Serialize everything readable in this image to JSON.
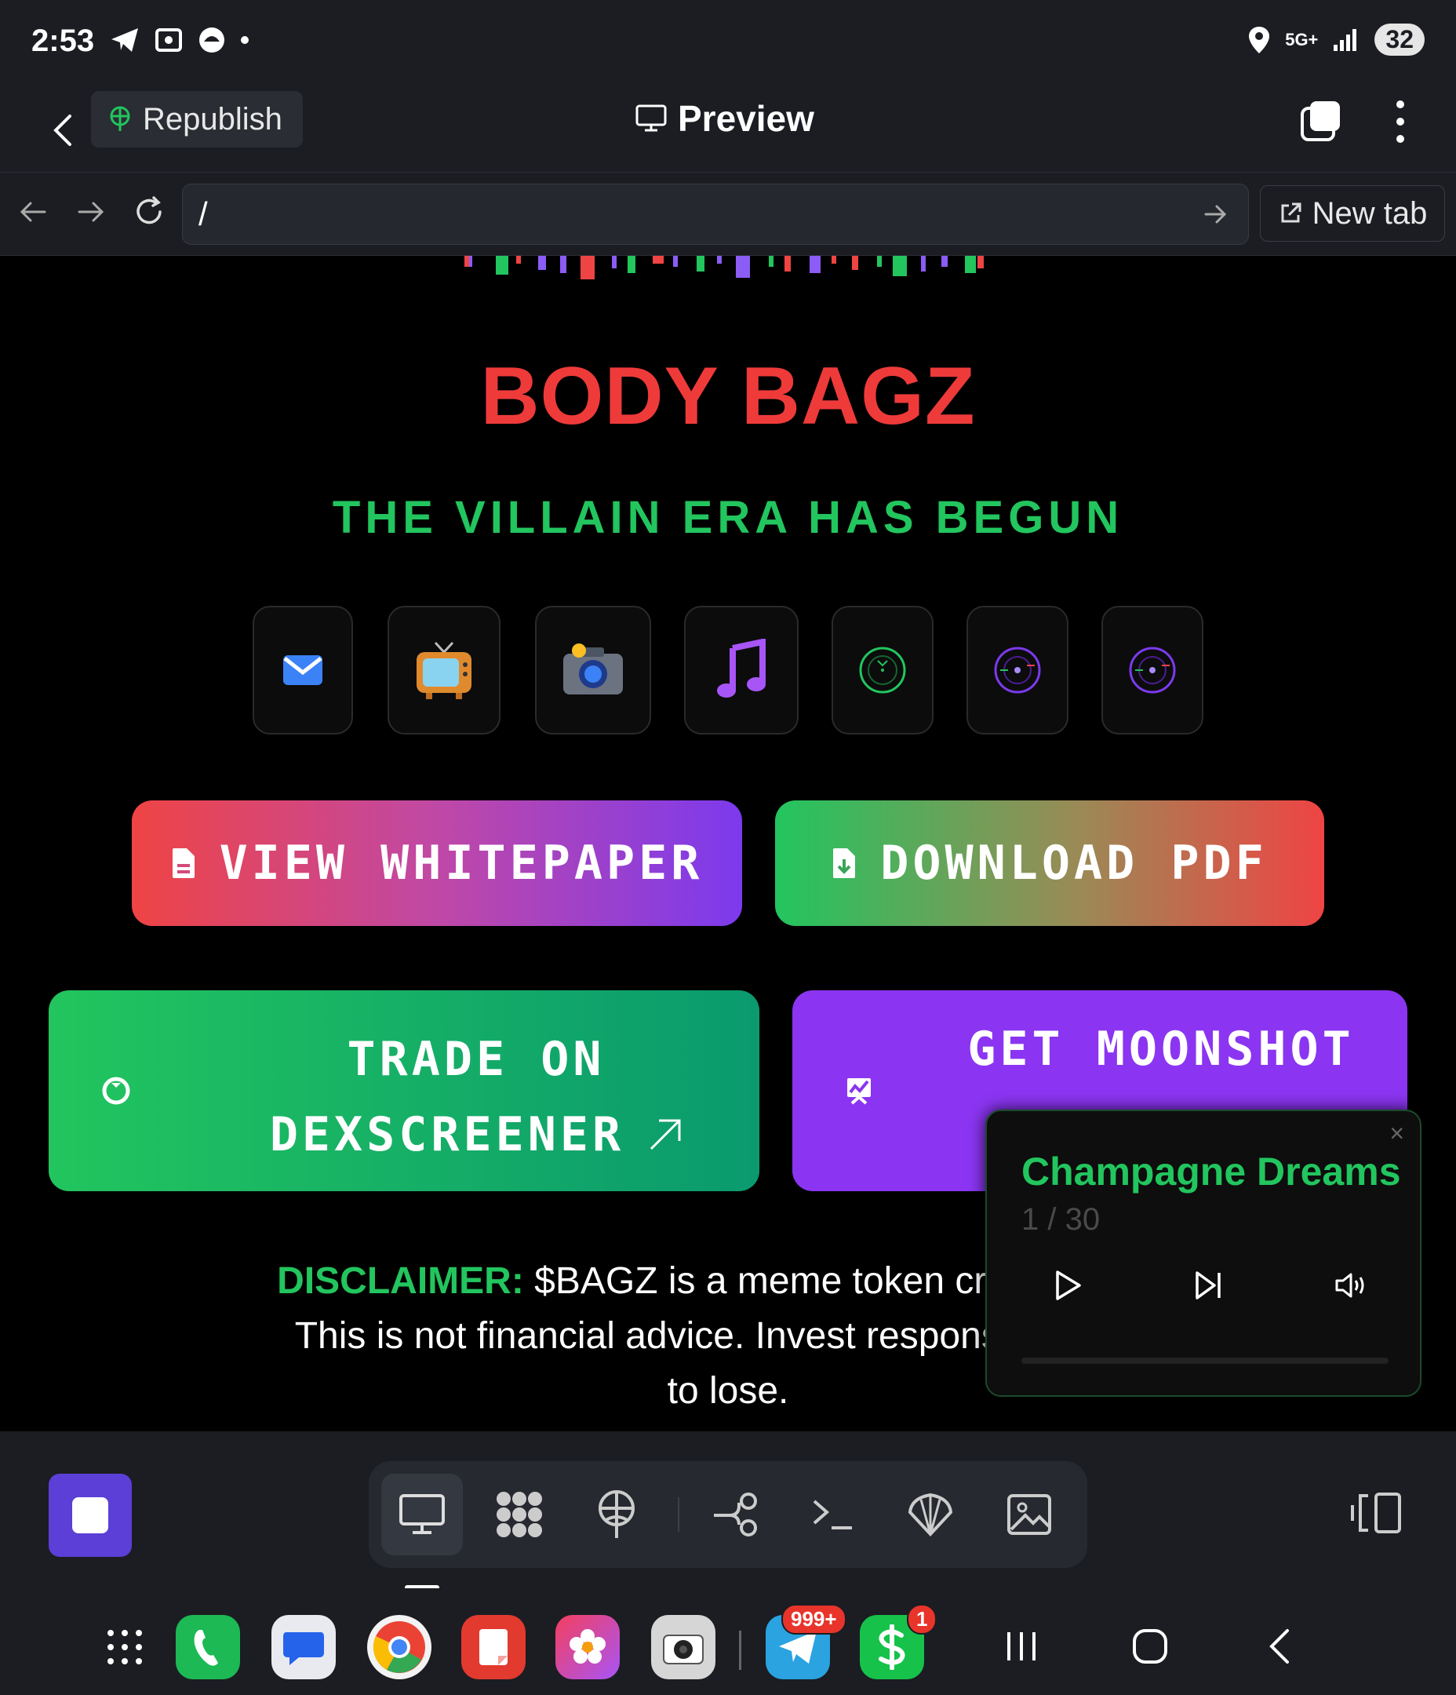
{
  "status_bar": {
    "time": "2:53",
    "network": "5G+",
    "battery": "32"
  },
  "app_bar": {
    "republish_label": "Republish",
    "preview_label": "Preview"
  },
  "url_bar": {
    "url": "/",
    "new_tab_label": "New tab"
  },
  "page": {
    "title": "BODY BAGZ",
    "subtitle": "THE VILLAIN ERA HAS BEGUN",
    "socials": [
      "mail-icon",
      "tv-icon",
      "camera-icon",
      "music-note-icon",
      "radar-icon",
      "orbit-icon",
      "orbit-icon"
    ],
    "buttons": {
      "whitepaper": "VIEW WHITEPAPER",
      "download": "DOWNLOAD PDF",
      "dex_line1": "TRADE ON",
      "dex_line2": "DEXSCREENER",
      "moonshot": "GET MOONSHOT"
    },
    "disclaimer": {
      "label": "DISCLAIMER:",
      "line1": "$BAGZ is a meme token created for er",
      "line2": "This is not financial advice. Invest responsibly and o",
      "line3": "to lose."
    }
  },
  "player": {
    "title": "Champagne Dreams",
    "count": "1 / 30",
    "close": "×"
  },
  "dock": {
    "telegram_badge": "999+",
    "cash_badge": "1"
  },
  "colors": {
    "accent_red": "#ef3a3a",
    "accent_green": "#22c55e",
    "accent_purple": "#8b35f2"
  }
}
